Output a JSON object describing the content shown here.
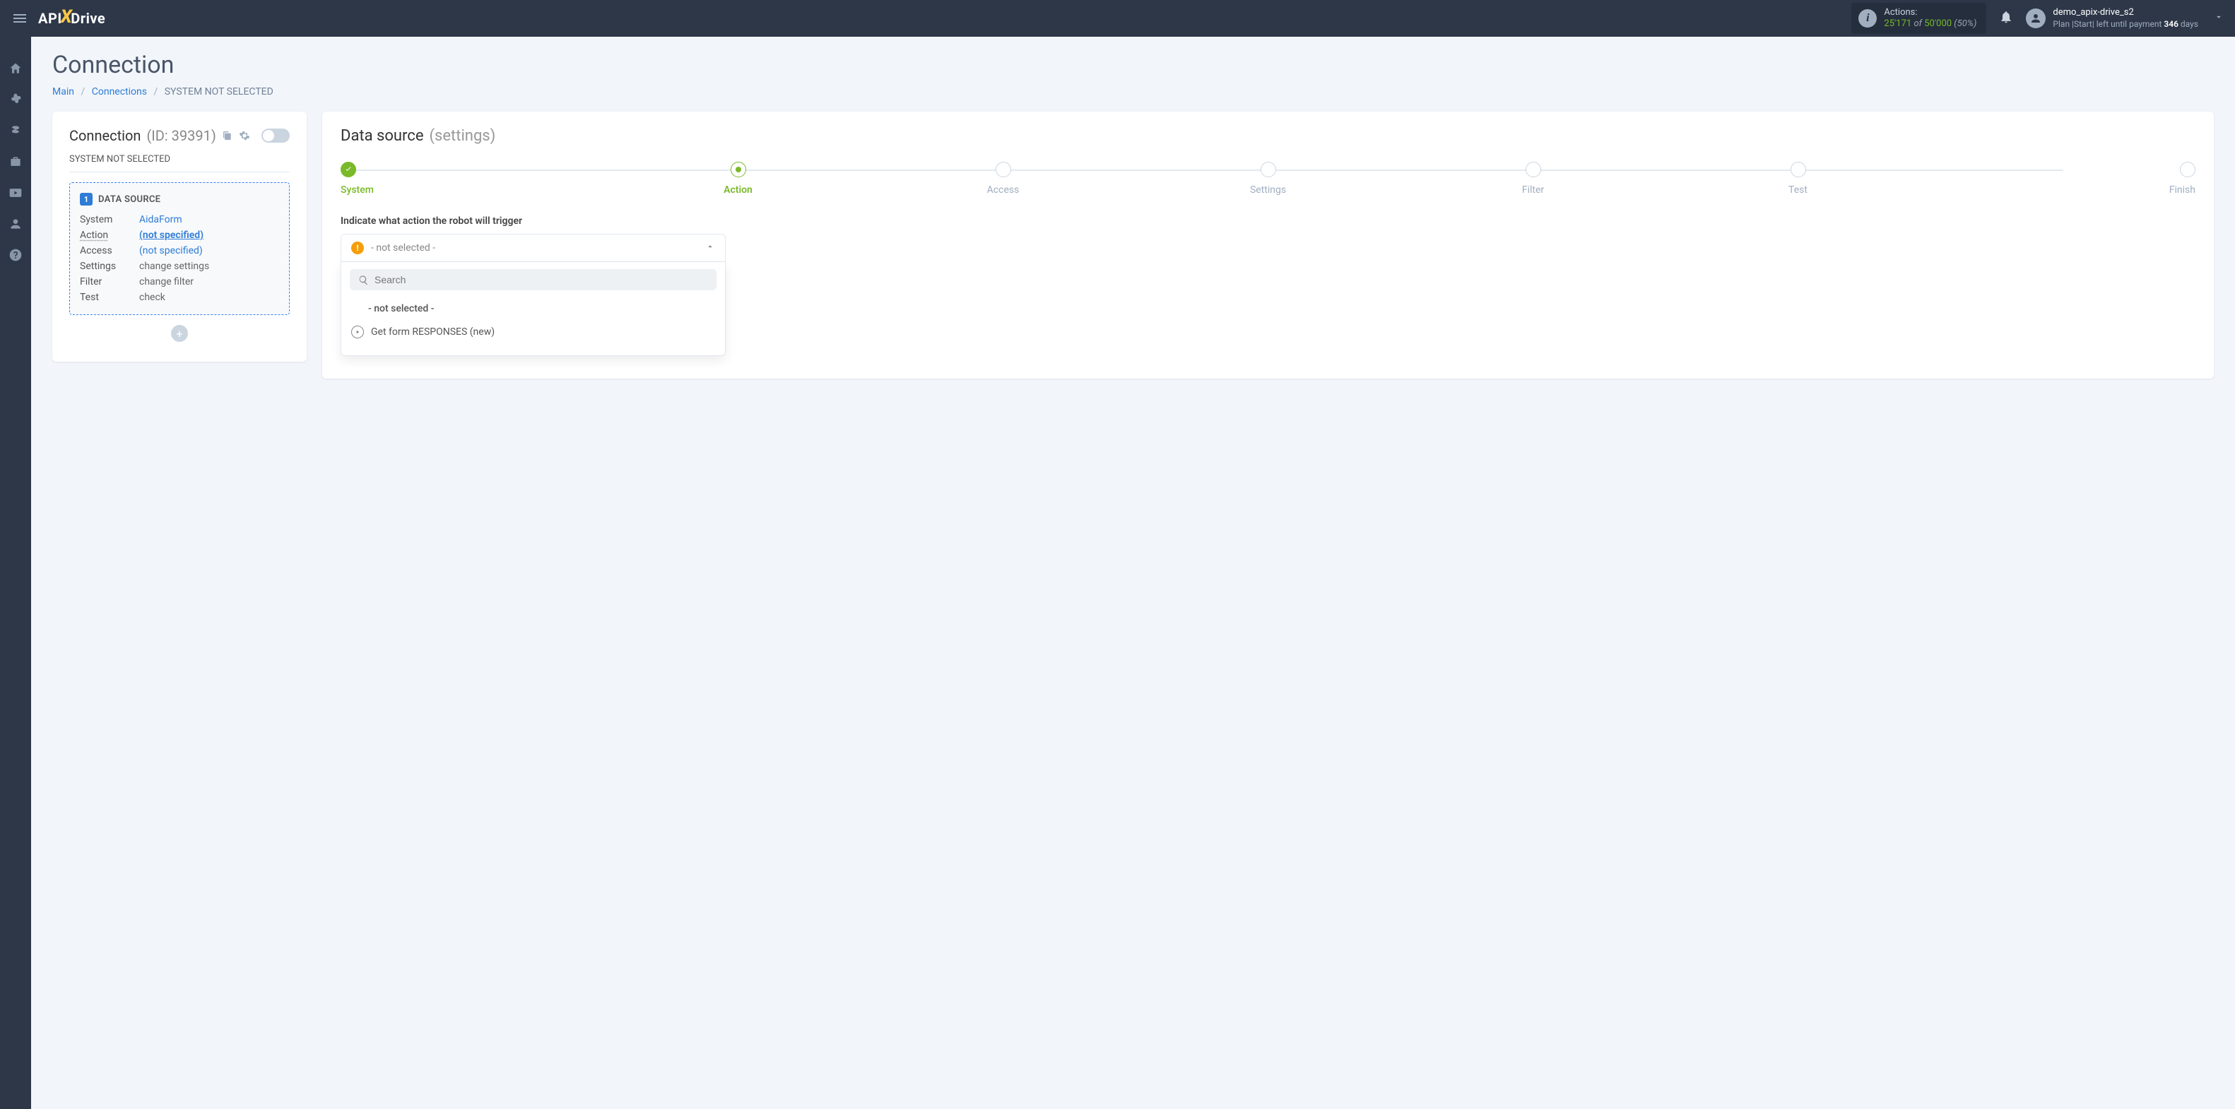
{
  "topbar": {
    "actions": {
      "label": "Actions:",
      "used": "25'171",
      "of": "of",
      "total": "50'000",
      "pct": "(50%)"
    },
    "user": {
      "name": "demo_apix-drive_s2",
      "plan_prefix": "Plan |Start| left until payment ",
      "days": "346",
      "days_suffix": " days"
    }
  },
  "page": {
    "title": "Connection",
    "crumbs": {
      "main": "Main",
      "connections": "Connections",
      "current": "SYSTEM NOT SELECTED"
    }
  },
  "left": {
    "title": "Connection",
    "id_label": "(ID: 39391)",
    "subtitle": "SYSTEM NOT SELECTED",
    "badge": "1",
    "box_title": "DATA SOURCE",
    "rows": {
      "system_k": "System",
      "system_v": "AidaForm",
      "action_k": "Action",
      "action_v": "(not specified)",
      "access_k": "Access",
      "access_v": "(not specified)",
      "settings_k": "Settings",
      "settings_v": "change settings",
      "filter_k": "Filter",
      "filter_v": "change filter",
      "test_k": "Test",
      "test_v": "check"
    }
  },
  "right": {
    "title": "Data source",
    "sub": "(settings)",
    "steps": {
      "s1": "System",
      "s2": "Action",
      "s3": "Access",
      "s4": "Settings",
      "s5": "Filter",
      "s6": "Test",
      "s7": "Finish"
    },
    "prompt": "Indicate what action the robot will trigger",
    "dropdown": {
      "selected": "- not selected -",
      "search_placeholder": "Search",
      "opt_none": "- not selected -",
      "opt_get": "Get form RESPONSES (new)"
    }
  }
}
